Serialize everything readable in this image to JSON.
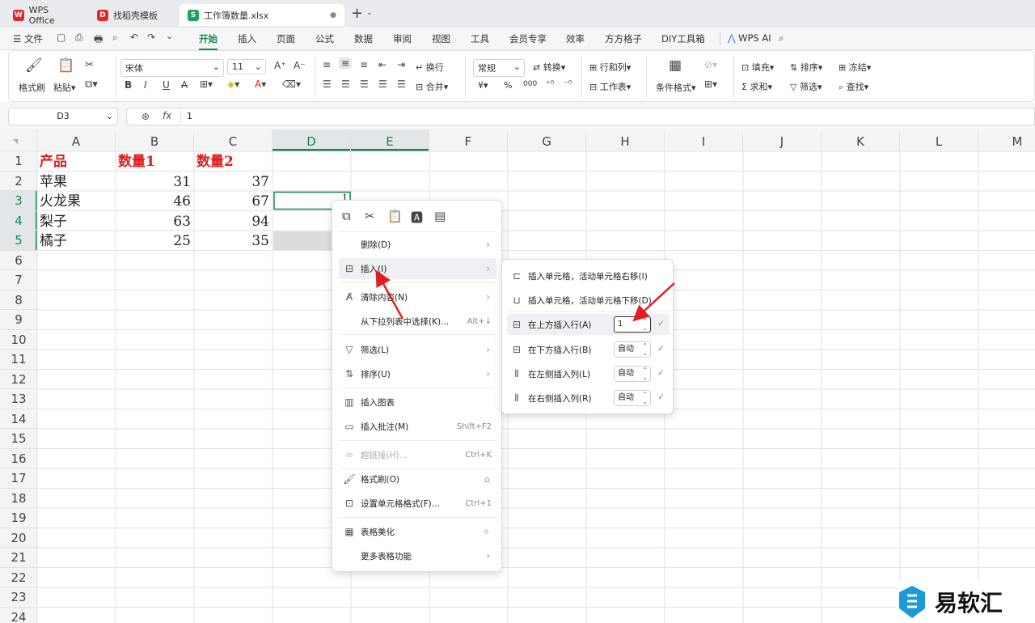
{
  "tabs": [
    {
      "label": "WPS Office",
      "icon": "wps-logo-icon"
    },
    {
      "label": "找稻壳模板",
      "icon": "docer-icon"
    },
    {
      "label": "工作簿数量.xlsx",
      "icon": "sheet-file-icon",
      "active": true
    }
  ],
  "menu": {
    "file": "文件",
    "items": [
      "开始",
      "插入",
      "页面",
      "公式",
      "数据",
      "审阅",
      "视图",
      "工具",
      "会员专享",
      "效率",
      "方方格子",
      "DIY工具箱"
    ],
    "active": "开始",
    "wps_ai": "WPS AI"
  },
  "ribbon": {
    "format_painter": "格式刷",
    "paste": "粘贴",
    "font_name": "宋体",
    "font_size": "11",
    "wrap": "换行",
    "merge": "合并",
    "number_format": "常规",
    "convert": "转换",
    "row_col": "行和列",
    "worksheet": "工作表",
    "cond_format": "条件格式",
    "fill": "填充",
    "sort": "排序",
    "freeze": "冻结",
    "sum": "求和",
    "filter": "筛选",
    "find": "查找",
    "currency": "¥",
    "percent": "%",
    "thousands": "000"
  },
  "formula_bar": {
    "name_box": "D3",
    "fx": "fx",
    "value": "1"
  },
  "sheet": {
    "columns": [
      "A",
      "B",
      "C",
      "D",
      "E",
      "F",
      "G",
      "H",
      "I",
      "J",
      "K",
      "L",
      "M"
    ],
    "rows": [
      "1",
      "2",
      "3",
      "4",
      "5",
      "6",
      "7",
      "8",
      "9",
      "10",
      "11",
      "12",
      "13",
      "14",
      "15",
      "16",
      "17",
      "18",
      "19",
      "20",
      "21",
      "22",
      "23",
      "24"
    ],
    "header": [
      "产品",
      "数量1",
      "数量2"
    ],
    "data": [
      [
        "苹果",
        "31",
        "37"
      ],
      [
        "火龙果",
        "46",
        "67"
      ],
      [
        "梨子",
        "63",
        "94"
      ],
      [
        "橘子",
        "25",
        "35"
      ]
    ],
    "active_cell_value": "1"
  },
  "context_menu": {
    "items": [
      {
        "label": "删除(D)",
        "icon": "delete-icon",
        "arrow": true
      },
      {
        "label": "插入(I)",
        "icon": "insert-icon",
        "arrow": true,
        "highlight": true
      },
      {
        "label": "清除内容(N)",
        "icon": "clear-icon",
        "arrow": true
      },
      {
        "label": "从下拉列表中选择(K)...",
        "shortcut": "Alt+↓"
      },
      {
        "label": "筛选(L)",
        "icon": "filter-icon",
        "arrow": true
      },
      {
        "label": "排序(U)",
        "icon": "sort-icon",
        "arrow": true
      },
      {
        "label": "插入图表",
        "icon": "chart-icon"
      },
      {
        "label": "插入批注(M)",
        "icon": "comment-icon",
        "shortcut": "Shift+F2"
      },
      {
        "label": "超链接(H)...",
        "icon": "link-icon",
        "shortcut": "Ctrl+K",
        "disabled": true
      },
      {
        "label": "格式刷(O)",
        "icon": "format-painter-icon"
      },
      {
        "label": "设置单元格格式(F)...",
        "icon": "cell-format-icon",
        "shortcut": "Ctrl+1"
      },
      {
        "label": "表格美化",
        "icon": "beautify-icon"
      },
      {
        "label": "更多表格功能",
        "arrow": true
      }
    ]
  },
  "submenu": {
    "items": [
      {
        "label": "插入单元格，活动单元格右移(I)",
        "icon": "insert-right-icon"
      },
      {
        "label": "插入单元格，活动单元格下移(D)",
        "icon": "insert-down-icon"
      },
      {
        "label": "在上方插入行(A)",
        "icon": "insert-row-above-icon",
        "value": "1",
        "highlight": true
      },
      {
        "label": "在下方插入行(B)",
        "icon": "insert-row-below-icon",
        "value": "自动"
      },
      {
        "label": "在左侧插入列(L)",
        "icon": "insert-col-left-icon",
        "value": "自动"
      },
      {
        "label": "在右侧插入列(R)",
        "icon": "insert-col-right-icon",
        "value": "自动"
      }
    ]
  },
  "watermark": {
    "text": "易软汇"
  },
  "colors": {
    "accent": "#138b4a",
    "header_red": "#e11b1b",
    "arrow_red": "#e02020"
  }
}
